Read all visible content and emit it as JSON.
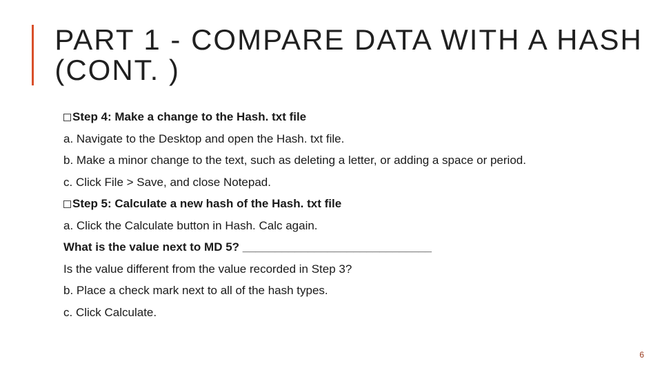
{
  "title": "PART 1 - COMPARE DATA WITH A HASH (CONT. )",
  "lines": {
    "step4": "Step 4: Make a change to the Hash. txt file",
    "l4a": "a. Navigate to the Desktop and open the Hash. txt file.",
    "l4b": "b. Make a minor change to the text, such as deleting a letter, or adding a space or period.",
    "l4c": "c. Click File > Save, and close Notepad.",
    "step5": "Step 5: Calculate a new hash of the Hash. txt file",
    "l5a": "a. Click the Calculate button in Hash. Calc again.",
    "q1": "What is the value next to MD 5? _____________________________",
    "q2": "Is the value different from the value recorded in Step 3?",
    "l5b": "b. Place a check mark next to all of the hash types.",
    "l5c": "c. Click Calculate."
  },
  "page_number": "6"
}
